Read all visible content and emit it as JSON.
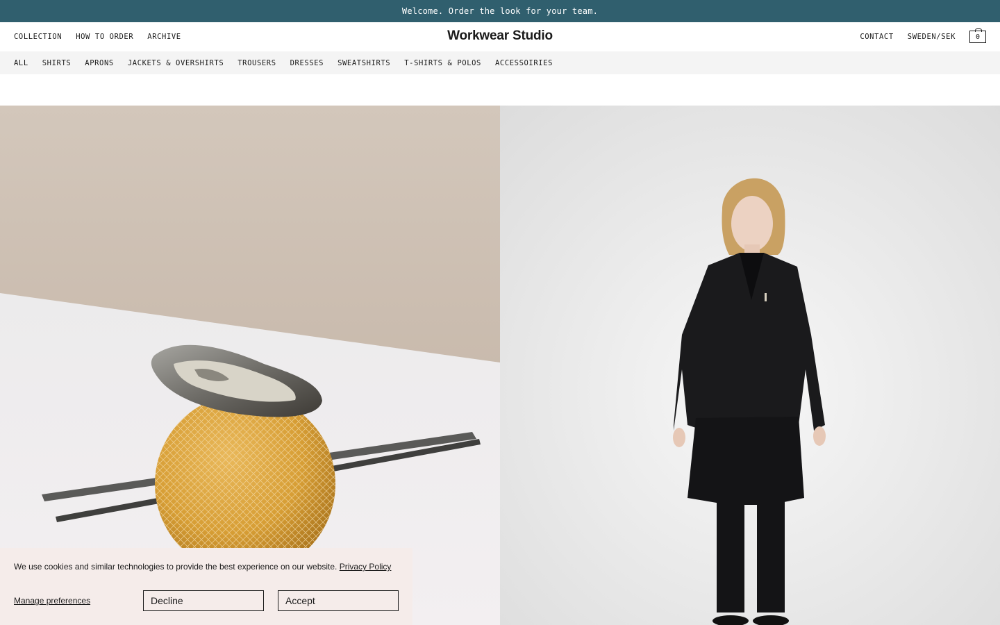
{
  "announcement": "Welcome. Order the look for your team.",
  "header": {
    "nav_left": [
      "COLLECTION",
      "HOW TO ORDER",
      "ARCHIVE"
    ],
    "logo": "Workwear Studio",
    "contact": "CONTACT",
    "region": "SWEDEN/SEK",
    "cart_count": "0",
    "cart_icon": "bag-icon"
  },
  "categories": [
    "ALL",
    "SHIRTS",
    "APRONS",
    "JACKETS & OVERSHIRTS",
    "TROUSERS",
    "DRESSES",
    "SWEATSHIRTS",
    "T-SHIRTS & POLOS",
    "ACCESSOIRIES"
  ],
  "hero": {
    "left_image": "oyster-on-melon-photo",
    "right_image": "model-in-black-workwear-photo"
  },
  "cookie": {
    "text": "We use cookies and similar technologies to provide the best experience on our website.",
    "policy_link": "Privacy Policy",
    "manage": "Manage preferences",
    "decline": "Decline",
    "accept": "Accept"
  },
  "colors": {
    "announcement_bg": "#305f6e",
    "category_bg": "#f4f4f4",
    "cookie_bg": "#f5ecea"
  }
}
